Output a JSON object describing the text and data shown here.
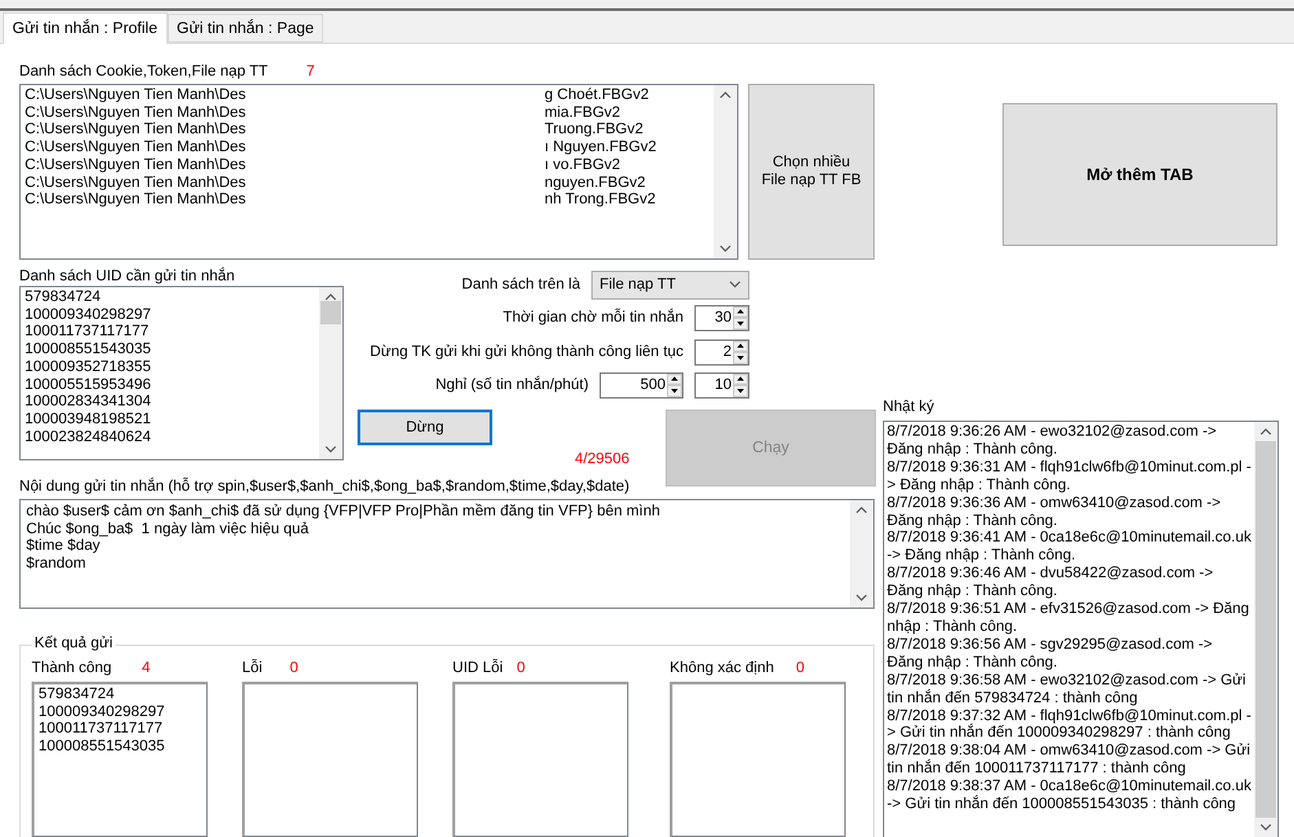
{
  "outer_tabs": [
    {
      "label": "Gửi tin nhắn : Profile",
      "selected": true
    },
    {
      "label": "Gửi tin nhắn : Page",
      "selected": false
    }
  ],
  "cookie_list": {
    "label": "Danh sách Cookie,Token,File nạp TT",
    "count": "7",
    "items": [
      {
        "start": "C:\\Users\\Nguyen Tien Manh\\Des",
        "end": "g Choét.FBGv2"
      },
      {
        "start": "C:\\Users\\Nguyen Tien Manh\\Des",
        "end": "mia.FBGv2"
      },
      {
        "start": "C:\\Users\\Nguyen Tien Manh\\Des",
        "end": "Truong.FBGv2"
      },
      {
        "start": "C:\\Users\\Nguyen Tien Manh\\Des",
        "end": "ı Nguyen.FBGv2"
      },
      {
        "start": "C:\\Users\\Nguyen Tien Manh\\Des",
        "end": "ı vo.FBGv2"
      },
      {
        "start": "C:\\Users\\Nguyen Tien Manh\\Des",
        "end": "nguyen.FBGv2"
      },
      {
        "start": "C:\\Users\\Nguyen Tien Manh\\Des",
        "end": "nh Trong.FBGv2"
      }
    ]
  },
  "choose_files_button": "Chọn nhiều File nạp TT FB",
  "open_tab_button": "Mở thêm TAB",
  "uid_list": {
    "label": "Danh sách UID cần gửi tin nhắn",
    "items": [
      "579834724",
      "100009340298297",
      "100011737117177",
      "100008551543035",
      "100009352718355",
      "100005515953496",
      "100002834341304",
      "100003948198521",
      "100023824840624"
    ]
  },
  "settings": {
    "list_type": {
      "label": "Danh sách trên là",
      "value": "File nạp TT"
    },
    "rows": [
      {
        "label": "Thời gian chờ mỗi tin nhắn",
        "values": [
          "30"
        ]
      },
      {
        "label": "Dừng TK gửi khi gửi không thành công liên tục",
        "values": [
          "2"
        ]
      },
      {
        "label": "Nghỉ (số tin nhắn/phút)",
        "values": [
          "500",
          "10"
        ]
      }
    ]
  },
  "stop_button": {
    "label": "Dừng",
    "focused": true,
    "disabled": false
  },
  "progress": "4/29506",
  "run_button": {
    "label": "Chạy",
    "focused": false,
    "disabled": true
  },
  "message": {
    "label": "Nội dung gửi tin nhắn (hỗ trợ spin,$user$,$anh_chi$,$ong_ba$,$random,$time,$day,$date)",
    "lines": [
      "chào $user$ cảm ơn $anh_chi$ đã sử dụng {VFP|VFP Pro|Phần mềm đăng tin VFP} bên mình",
      "Chúc $ong_ba$  1 ngày làm việc hiệu quả",
      "$time $day",
      "$random"
    ]
  },
  "results": {
    "title": "Kết quả gửi",
    "columns": [
      {
        "label": "Thành công",
        "count": "4",
        "items": [
          "579834724",
          "100009340298297",
          "100011737117177",
          "100008551543035"
        ]
      },
      {
        "label": "Lỗi",
        "count": "0"
      },
      {
        "label": "UID Lỗi",
        "count": "0"
      },
      {
        "label": "Không xác định",
        "count": "0"
      }
    ]
  },
  "log": {
    "label": "Nhật ký",
    "entries": [
      "8/7/2018 9:36:26 AM - ewo32102@zasod.com -> Đăng nhập : Thành công.",
      "8/7/2018 9:36:31 AM - flqh91clw6fb@10minut.com.pl -> Đăng nhập : Thành công.",
      "8/7/2018 9:36:36 AM - omw63410@zasod.com -> Đăng nhập : Thành công.",
      "8/7/2018 9:36:41 AM - 0ca18e6c@10minutemail.co.uk -> Đăng nhập : Thành công.",
      "8/7/2018 9:36:46 AM - dvu58422@zasod.com -> Đăng nhập : Thành công.",
      "8/7/2018 9:36:51 AM - efv31526@zasod.com -> Đăng nhập : Thành công.",
      "8/7/2018 9:36:56 AM - sgv29295@zasod.com -> Đăng nhập : Thành công.",
      "8/7/2018 9:36:58 AM - ewo32102@zasod.com -> Gửi tin nhắn đến 579834724 : thành công",
      "8/7/2018 9:37:32 AM - flqh91clw6fb@10minut.com.pl -> Gửi tin nhắn đến 100009340298297 : thành công",
      "8/7/2018 9:38:04 AM - omw63410@zasod.com -> Gửi tin nhắn đến 100011737117177 : thành công",
      "8/7/2018 9:38:37 AM - 0ca18e6c@10minutemail.co.uk -> Gửi tin nhắn đến 100008551543035 : thành công"
    ]
  }
}
